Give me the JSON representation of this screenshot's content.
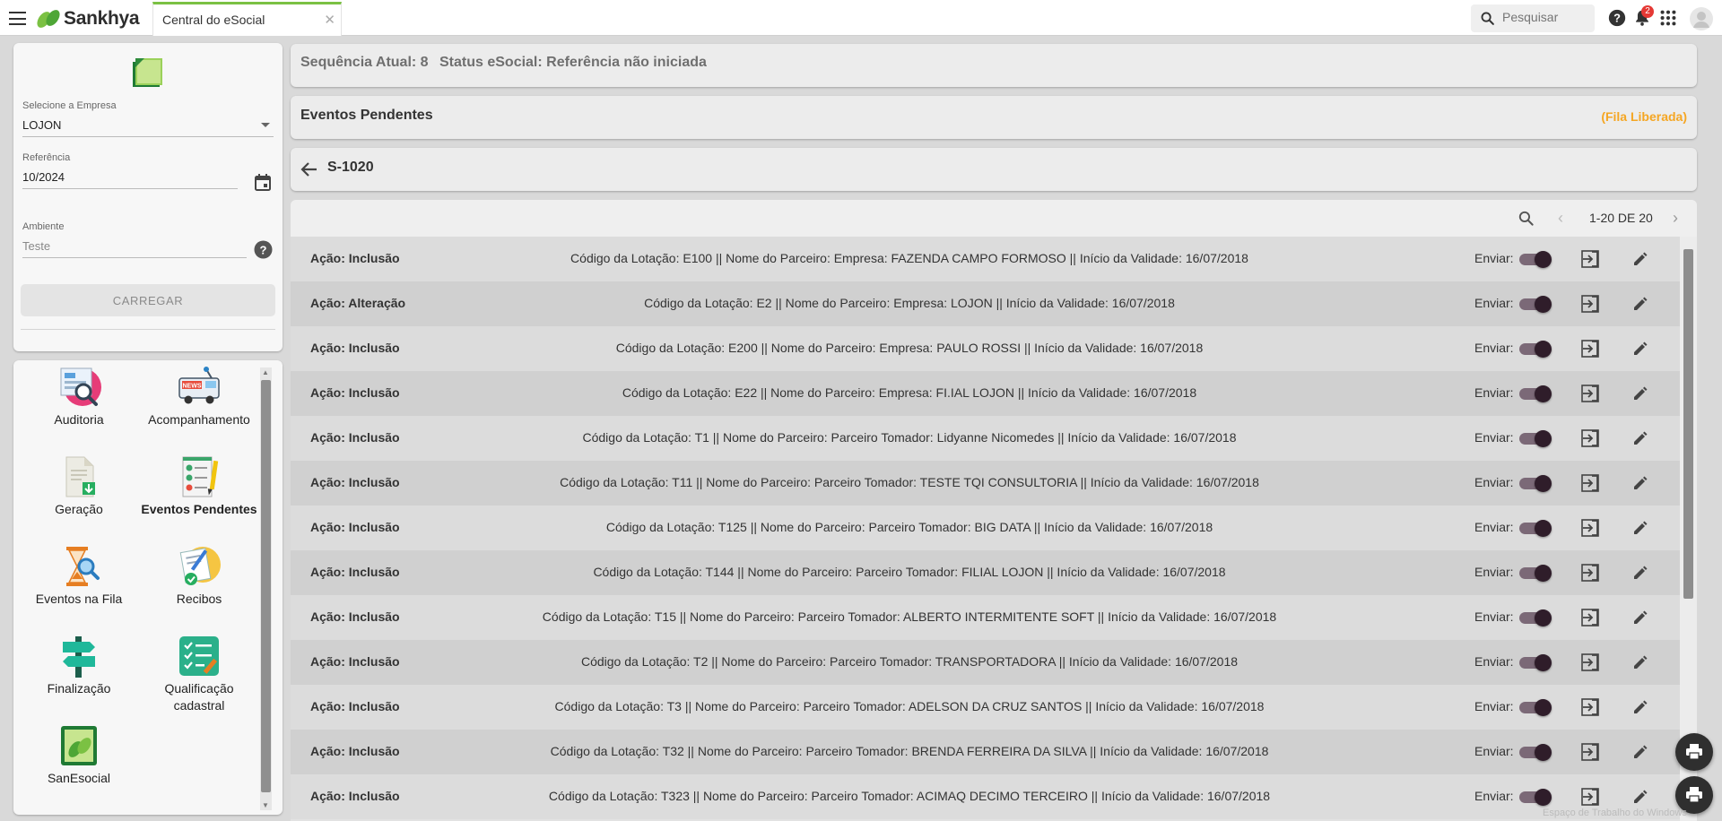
{
  "app": {
    "brand": "Sankhya",
    "tab_label": "Central do eSocial",
    "search_placeholder": "Pesquisar",
    "notification_count": "2",
    "colors": {
      "accent_green": "#7bc143",
      "orange_status": "#f5a623",
      "toggle_knob": "#2f1d2a"
    }
  },
  "form": {
    "empresa_label": "Selecione a Empresa",
    "empresa_value": "LOJON",
    "referencia_label": "Referência",
    "referencia_value": "10/2024",
    "ambiente_label": "Ambiente",
    "ambiente_value": "Teste",
    "load_button": "CARREGAR"
  },
  "menu": {
    "auditoria": "Auditoria",
    "acompanhamento": "Acompanhamento",
    "geracao": "Geração",
    "eventos_pendentes": "Eventos Pendentes",
    "eventos_fila": "Eventos na Fila",
    "recibos": "Recibos",
    "finalizacao": "Finalização",
    "qualificacao_1": "Qualificação",
    "qualificacao_2": "cadastral",
    "sanesocial": "SanEsocial"
  },
  "status": {
    "sequencia": "Sequência Atual: 8",
    "status_esocial": "Status eSocial: Referência não iniciada"
  },
  "pending": {
    "title": "Eventos Pendentes",
    "queue_status": "(Fila Liberada)"
  },
  "event": {
    "code": "S-1020"
  },
  "list": {
    "pagination": "1-20 DE 20",
    "send_label": "Enviar:",
    "rows": [
      {
        "action": "Ação: Inclusão",
        "desc": "Código da Lotação: E100 || Nome do Parceiro: Empresa: FAZENDA CAMPO FORMOSO || Início da Validade: 16/07/2018"
      },
      {
        "action": "Ação: Alteração",
        "desc": "Código da Lotação: E2 || Nome do Parceiro: Empresa: LOJON || Início da Validade: 16/07/2018"
      },
      {
        "action": "Ação: Inclusão",
        "desc": "Código da Lotação: E200 || Nome do Parceiro: Empresa: PAULO ROSSI || Início da Validade: 16/07/2018"
      },
      {
        "action": "Ação: Inclusão",
        "desc": "Código da Lotação: E22 || Nome do Parceiro: Empresa: FI.IAL LOJON || Início da Validade: 16/07/2018"
      },
      {
        "action": "Ação: Inclusão",
        "desc": "Código da Lotação: T1 || Nome do Parceiro: Parceiro Tomador: Lidyanne Nicomedes || Início da Validade: 16/07/2018"
      },
      {
        "action": "Ação: Inclusão",
        "desc": "Código da Lotação: T11 || Nome do Parceiro: Parceiro Tomador: TESTE TQI CONSULTORIA || Início da Validade: 16/07/2018"
      },
      {
        "action": "Ação: Inclusão",
        "desc": "Código da Lotação: T125 || Nome do Parceiro: Parceiro Tomador: BIG DATA || Início da Validade: 16/07/2018"
      },
      {
        "action": "Ação: Inclusão",
        "desc": "Código da Lotação: T144 || Nome do Parceiro: Parceiro Tomador: FILIAL LOJON || Início da Validade: 16/07/2018"
      },
      {
        "action": "Ação: Inclusão",
        "desc": "Código da Lotação: T15 || Nome do Parceiro: Parceiro Tomador: ALBERTO INTERMITENTE SOFT || Início da Validade: 16/07/2018"
      },
      {
        "action": "Ação: Inclusão",
        "desc": "Código da Lotação: T2 || Nome do Parceiro: Parceiro Tomador: TRANSPORTADORA || Início da Validade: 16/07/2018"
      },
      {
        "action": "Ação: Inclusão",
        "desc": "Código da Lotação: T3 || Nome do Parceiro: Parceiro Tomador: ADELSON DA CRUZ SANTOS || Início da Validade: 16/07/2018"
      },
      {
        "action": "Ação: Inclusão",
        "desc": "Código da Lotação: T32 || Nome do Parceiro: Parceiro Tomador: BRENDA FERREIRA DA SILVA || Início da Validade: 16/07/2018"
      },
      {
        "action": "Ação: Inclusão",
        "desc": "Código da Lotação: T323 || Nome do Parceiro: Parceiro Tomador: ACIMAQ DECIMO TERCEIRO || Início da Validade: 16/07/2018"
      }
    ]
  },
  "watermark": "Espaço de Trabalho do Windows"
}
